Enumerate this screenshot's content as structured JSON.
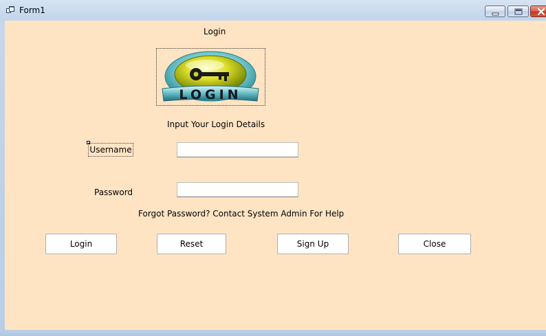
{
  "window": {
    "title": "Form1"
  },
  "form": {
    "heading": "Login",
    "logo_text": "LOGIN",
    "subtitle": "Input Your Login Details",
    "username_label": "Username",
    "username_value": "",
    "password_label": "Password",
    "password_value": "",
    "forgot_text": "Forgot Password? Contact System Admin For Help"
  },
  "buttons": {
    "login": "Login",
    "reset": "Reset",
    "signup": "Sign Up",
    "close": "Close"
  },
  "colors": {
    "form_background": "#ffe4c4",
    "titlebar": "#c7d7ea",
    "close_button": "#c43a22"
  },
  "icons": {
    "app": "form-window-icon",
    "minimize": "minimize-icon",
    "maximize": "maximize-icon",
    "close": "close-icon",
    "logo": "key-login-logo"
  }
}
